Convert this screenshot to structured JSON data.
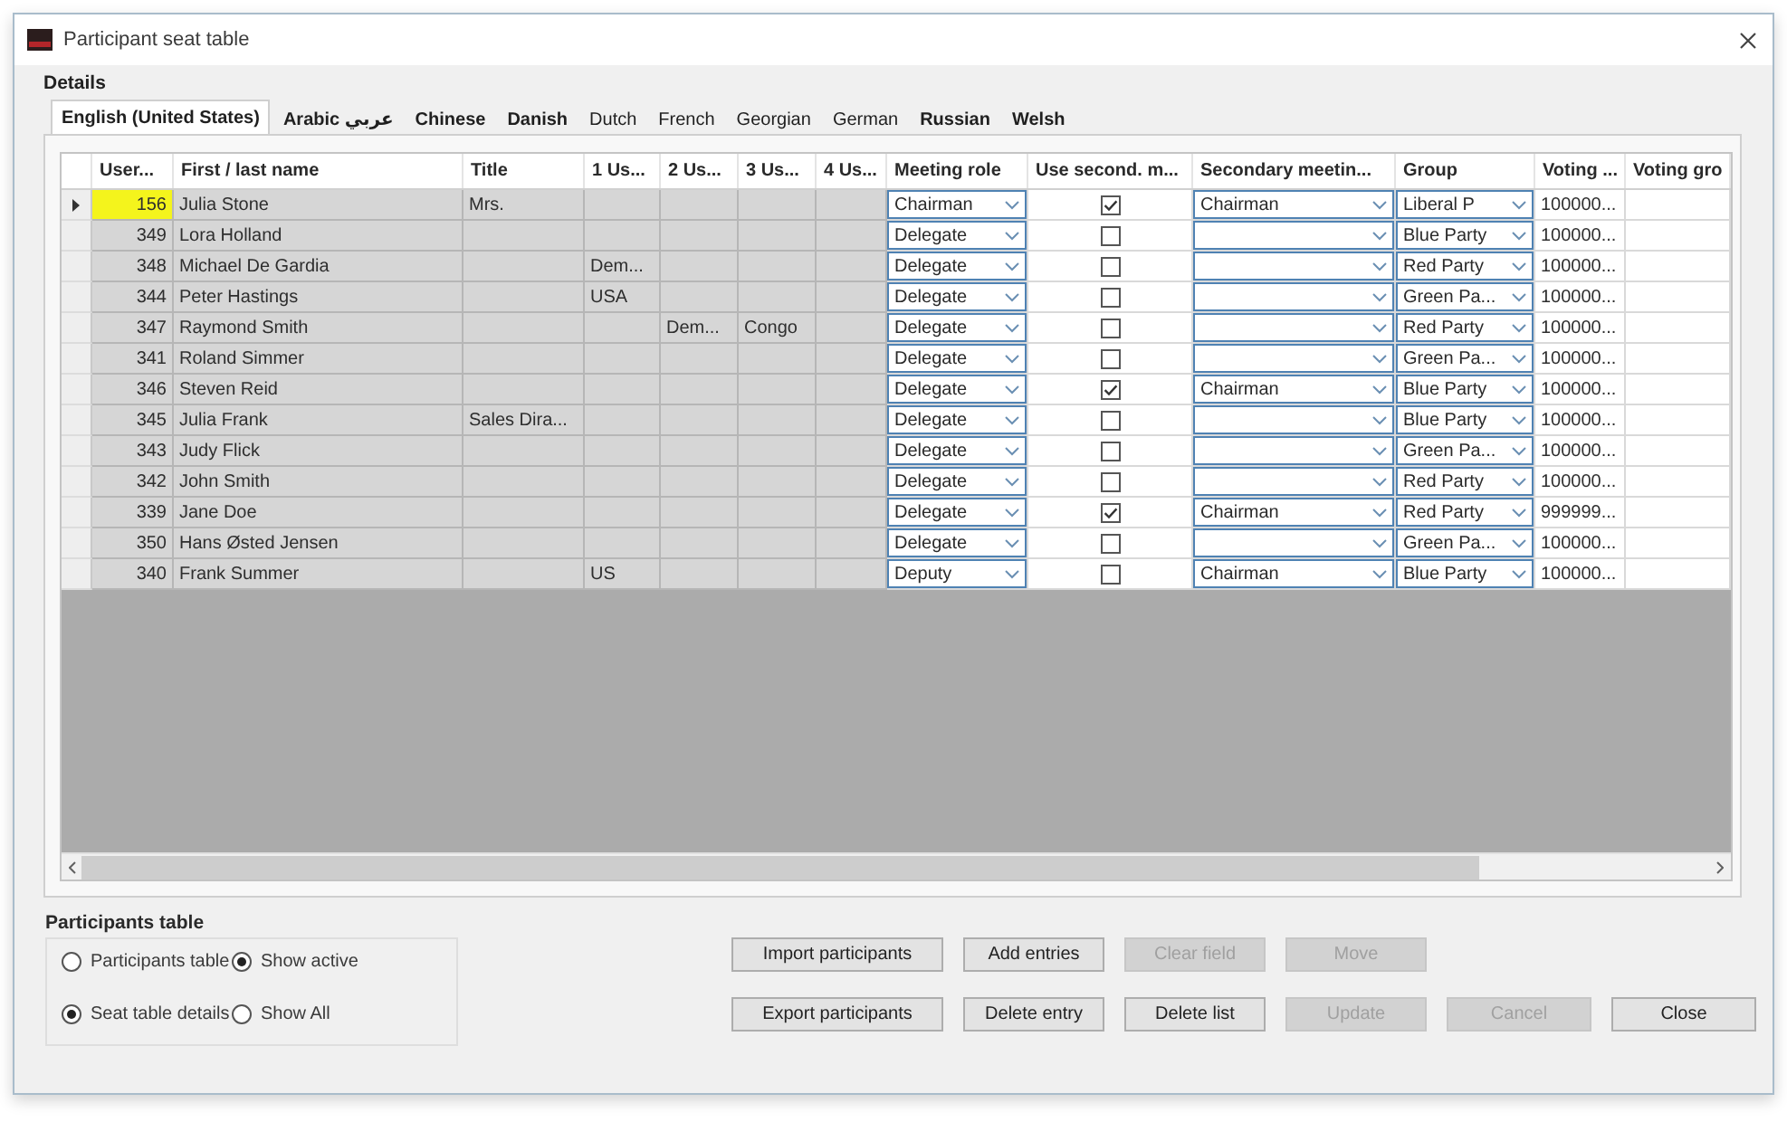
{
  "window": {
    "title": "Participant seat table"
  },
  "details": {
    "label": "Details"
  },
  "tabs": [
    {
      "label": "English (United States)",
      "selected": true,
      "emphasized": true
    },
    {
      "label": "Arabic عربي",
      "selected": false,
      "emphasized": true
    },
    {
      "label": "Chinese",
      "selected": false,
      "emphasized": true
    },
    {
      "label": "Danish",
      "selected": false,
      "emphasized": true
    },
    {
      "label": "Dutch",
      "selected": false,
      "emphasized": false
    },
    {
      "label": "French",
      "selected": false,
      "emphasized": false
    },
    {
      "label": "Georgian",
      "selected": false,
      "emphasized": false
    },
    {
      "label": "German",
      "selected": false,
      "emphasized": false
    },
    {
      "label": "Russian",
      "selected": false,
      "emphasized": true
    },
    {
      "label": "Welsh",
      "selected": false,
      "emphasized": true
    }
  ],
  "table": {
    "columns": [
      {
        "label": "User...",
        "kind": "number"
      },
      {
        "label": "First / last name",
        "kind": "readonly"
      },
      {
        "label": "Title",
        "kind": "readonly"
      },
      {
        "label": "1 Us...",
        "kind": "readonly"
      },
      {
        "label": "2 Us...",
        "kind": "readonly"
      },
      {
        "label": "3 Us...",
        "kind": "readonly"
      },
      {
        "label": "4 Us...",
        "kind": "readonly"
      },
      {
        "label": "Meeting role",
        "kind": "dropdown"
      },
      {
        "label": "Use second. m...",
        "kind": "checkbox"
      },
      {
        "label": "Secondary meetin...",
        "kind": "dropdown"
      },
      {
        "label": "Group",
        "kind": "dropdown"
      },
      {
        "label": "Voting ...",
        "kind": "text"
      },
      {
        "label": "Voting gro",
        "kind": "text"
      }
    ],
    "rows": [
      {
        "selected": true,
        "cells": [
          {
            "text": "156"
          },
          {
            "text": "Julia Stone"
          },
          {
            "text": "Mrs."
          },
          {},
          {},
          {},
          {},
          {
            "text": "Chairman"
          },
          {
            "checked": true
          },
          {
            "text": "Chairman"
          },
          {
            "text": "Liberal P"
          },
          {
            "text": "100000..."
          },
          {}
        ]
      },
      {
        "selected": false,
        "cells": [
          {
            "text": "349"
          },
          {
            "text": "Lora Holland"
          },
          {},
          {},
          {},
          {},
          {},
          {
            "text": "Delegate"
          },
          {
            "checked": false
          },
          {},
          {
            "text": "Blue Party"
          },
          {
            "text": "100000..."
          },
          {}
        ]
      },
      {
        "selected": false,
        "cells": [
          {
            "text": "348"
          },
          {
            "text": "Michael De Gardia"
          },
          {},
          {
            "text": "Dem..."
          },
          {},
          {},
          {},
          {
            "text": "Delegate"
          },
          {
            "checked": false
          },
          {},
          {
            "text": "Red Party"
          },
          {
            "text": "100000..."
          },
          {}
        ]
      },
      {
        "selected": false,
        "cells": [
          {
            "text": "344"
          },
          {
            "text": "Peter Hastings"
          },
          {},
          {
            "text": "USA"
          },
          {},
          {},
          {},
          {
            "text": "Delegate"
          },
          {
            "checked": false
          },
          {},
          {
            "text": "Green Pa..."
          },
          {
            "text": "100000..."
          },
          {}
        ]
      },
      {
        "selected": false,
        "cells": [
          {
            "text": "347"
          },
          {
            "text": "Raymond Smith"
          },
          {},
          {},
          {
            "text": "Dem..."
          },
          {
            "text": "Congo"
          },
          {},
          {
            "text": "Delegate"
          },
          {
            "checked": false
          },
          {},
          {
            "text": "Red Party"
          },
          {
            "text": "100000..."
          },
          {}
        ]
      },
      {
        "selected": false,
        "cells": [
          {
            "text": "341"
          },
          {
            "text": "Roland Simmer"
          },
          {},
          {},
          {},
          {},
          {},
          {
            "text": "Delegate"
          },
          {
            "checked": false
          },
          {},
          {
            "text": "Green Pa..."
          },
          {
            "text": "100000..."
          },
          {}
        ]
      },
      {
        "selected": false,
        "cells": [
          {
            "text": "346"
          },
          {
            "text": "Steven Reid"
          },
          {},
          {},
          {},
          {},
          {},
          {
            "text": "Delegate"
          },
          {
            "checked": true
          },
          {
            "text": "Chairman"
          },
          {
            "text": "Blue Party"
          },
          {
            "text": "100000..."
          },
          {}
        ]
      },
      {
        "selected": false,
        "cells": [
          {
            "text": "345"
          },
          {
            "text": "Julia Frank"
          },
          {
            "text": "Sales Dira..."
          },
          {},
          {},
          {},
          {},
          {
            "text": "Delegate"
          },
          {
            "checked": false
          },
          {},
          {
            "text": "Blue Party"
          },
          {
            "text": "100000..."
          },
          {}
        ]
      },
      {
        "selected": false,
        "cells": [
          {
            "text": "343"
          },
          {
            "text": "Judy Flick"
          },
          {},
          {},
          {},
          {},
          {},
          {
            "text": "Delegate"
          },
          {
            "checked": false
          },
          {},
          {
            "text": "Green Pa..."
          },
          {
            "text": "100000..."
          },
          {}
        ]
      },
      {
        "selected": false,
        "cells": [
          {
            "text": "342"
          },
          {
            "text": "John Smith"
          },
          {},
          {},
          {},
          {},
          {},
          {
            "text": "Delegate"
          },
          {
            "checked": false
          },
          {},
          {
            "text": "Red Party"
          },
          {
            "text": "100000..."
          },
          {}
        ]
      },
      {
        "selected": false,
        "cells": [
          {
            "text": "339"
          },
          {
            "text": "Jane Doe"
          },
          {},
          {},
          {},
          {},
          {},
          {
            "text": "Delegate"
          },
          {
            "checked": true
          },
          {
            "text": "Chairman"
          },
          {
            "text": "Red Party"
          },
          {
            "text": "999999..."
          },
          {}
        ]
      },
      {
        "selected": false,
        "cells": [
          {
            "text": "350"
          },
          {
            "text": "Hans Østed Jensen"
          },
          {},
          {},
          {},
          {},
          {},
          {
            "text": "Delegate"
          },
          {
            "checked": false
          },
          {},
          {
            "text": "Green Pa..."
          },
          {
            "text": "100000..."
          },
          {}
        ]
      },
      {
        "selected": false,
        "cells": [
          {
            "text": "340"
          },
          {
            "text": "Frank Summer"
          },
          {},
          {
            "text": "US"
          },
          {},
          {},
          {},
          {
            "text": "Deputy"
          },
          {
            "checked": false
          },
          {
            "text": "Chairman"
          },
          {
            "text": "Blue Party"
          },
          {
            "text": "100000..."
          },
          {}
        ]
      }
    ]
  },
  "participants_table": {
    "title": "Participants table",
    "options": [
      {
        "label": "Participants table",
        "selected": false
      },
      {
        "label": "Show active",
        "selected": true
      },
      {
        "label": "Seat table details",
        "selected": true
      },
      {
        "label": "Show All",
        "selected": false
      }
    ]
  },
  "button_rows": [
    {
      "buttons": [
        {
          "label": "Import participants",
          "disabled": false
        },
        {
          "label": "Add entries",
          "disabled": false
        },
        {
          "label": "Clear field",
          "disabled": true
        },
        {
          "label": "Move",
          "disabled": true
        }
      ]
    },
    {
      "buttons": [
        {
          "label": "Export participants",
          "disabled": false
        },
        {
          "label": "Delete entry",
          "disabled": false
        },
        {
          "label": "Delete list",
          "disabled": false
        },
        {
          "label": "Update",
          "disabled": true
        },
        {
          "label": "Cancel",
          "disabled": true
        },
        {
          "label": "Close",
          "disabled": false
        }
      ]
    }
  ]
}
